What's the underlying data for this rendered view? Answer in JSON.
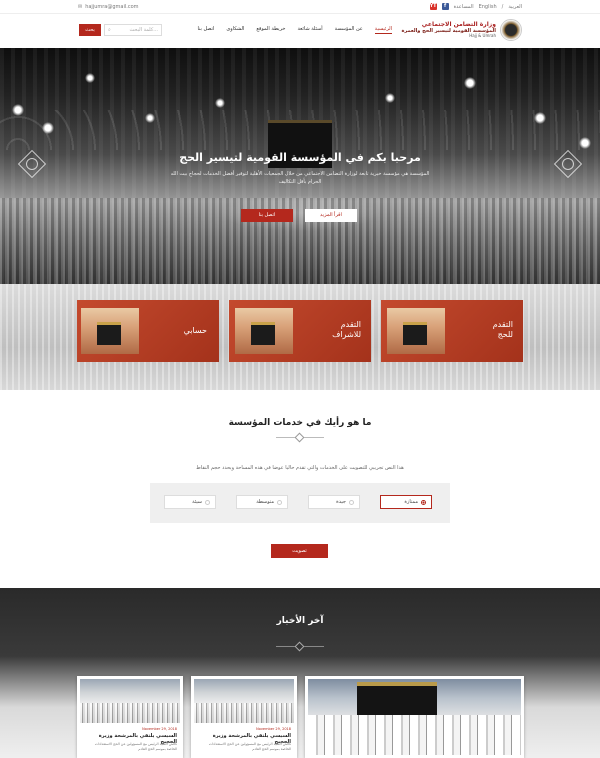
{
  "topbar": {
    "email": "hajjumra@gmail.com",
    "lang_ar": "العربية",
    "lang_en": "English",
    "help": "المساعدة",
    "yt": "YT",
    "fb": "f"
  },
  "header": {
    "logo_line1": "وزارة التضامن الاجتماعي",
    "logo_line2": "المؤسسة القومية لتيسير الحج والعمرة",
    "logo_line3": "Hajj & Umrah",
    "nav": [
      "الرئيسية",
      "عن المؤسسة",
      "أسئلة شائعة",
      "خريطة الموقع",
      "الشكاوى",
      "اتصل بنا"
    ],
    "search_placeholder": "كلمة البحث...",
    "search_button": "بحث"
  },
  "hero": {
    "title": "مرحبا بكم في المؤسسة القومية لتيسير الحج",
    "description": "المؤسسة هي مؤسسة خيرية تابعة لوزارة التضامن الاجتماعي من خلال الجمعيات الأهلية لتوفير أفضل الخدمات لحجاج بيت الله الحرام بأقل التكاليف",
    "more_button": "اقرأ المزيد",
    "contact_button": "اتصل بنا"
  },
  "features": [
    {
      "label_l1": "التقدم",
      "label_l2": "للحج"
    },
    {
      "label_l1": "التقدم",
      "label_l2": "للاشراف"
    },
    {
      "label_l1": "حسابي",
      "label_l2": ""
    }
  ],
  "survey": {
    "title": "ما هو رأيك في خدمات المؤسسة",
    "question": "هذا النص تجريبي للتصويت على الخدمات والتي تقدم حاليا عوضا في هذه المساحة ويحدد حجم النقاط",
    "options": [
      "ممتازة",
      "جيدة",
      "متوسطة",
      "سيئة"
    ],
    "selected": 0,
    "submit": "تصويت"
  },
  "news": {
    "title": "آخر الأخبار",
    "items": [
      {
        "date": "November 29, 2018",
        "title": "السيسي يلتقي بالمرشحة وزيرة الحجيج",
        "excerpt": "ناقش السيد الرئيس مع المسؤولين عن الحج الاستعدادات الخاصة بموسم الحج القادم"
      },
      {
        "date": "November 29, 2018",
        "title": "السيسي يلتقي بالمرشحة وزيرة الحجيج",
        "excerpt": "ناقش السيد الرئيس مع المسؤولين عن الحج الاستعدادات الخاصة بموسم الحج القادم"
      }
    ]
  }
}
